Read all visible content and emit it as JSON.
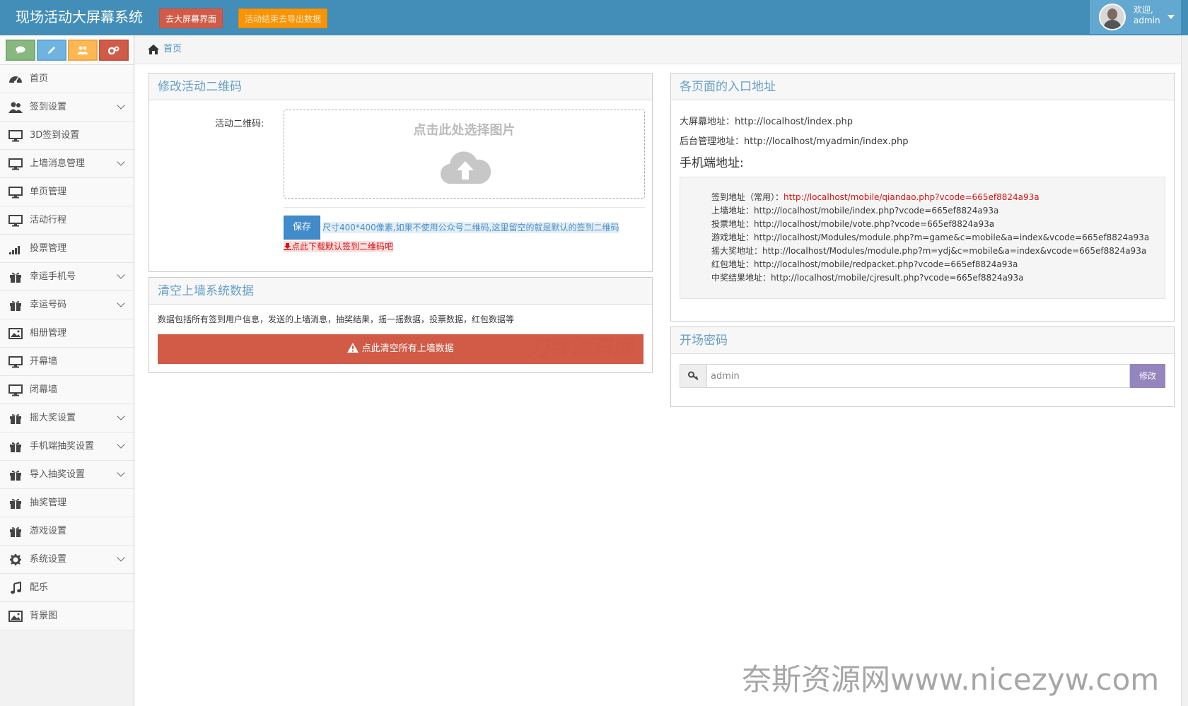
{
  "navbar": {
    "brand": "现场活动大屏幕系统",
    "btn_screen": "去大屏幕界面",
    "btn_export": "活动结束去导出数据",
    "welcome": "欢迎,",
    "username": "admin"
  },
  "shortcuts": [
    "comments-icon",
    "pencil-icon",
    "users-icon",
    "cogs-icon"
  ],
  "sidebar": {
    "items": [
      {
        "label": "首页",
        "icon": "dashboard-icon",
        "expandable": false
      },
      {
        "label": "签到设置",
        "icon": "users-icon",
        "expandable": true
      },
      {
        "label": "3D签到设置",
        "icon": "desktop-icon",
        "expandable": false
      },
      {
        "label": "上墙消息管理",
        "icon": "desktop-icon",
        "expandable": true
      },
      {
        "label": "单页管理",
        "icon": "desktop-icon",
        "expandable": false
      },
      {
        "label": "活动行程",
        "icon": "desktop-icon",
        "expandable": false
      },
      {
        "label": "投票管理",
        "icon": "signal-icon",
        "expandable": false
      },
      {
        "label": "幸运手机号",
        "icon": "gift-icon",
        "expandable": true
      },
      {
        "label": "幸运号码",
        "icon": "gift-icon",
        "expandable": true
      },
      {
        "label": "相册管理",
        "icon": "picture-icon",
        "expandable": false
      },
      {
        "label": "开幕墙",
        "icon": "desktop-icon",
        "expandable": false
      },
      {
        "label": "闭幕墙",
        "icon": "desktop-icon",
        "expandable": false
      },
      {
        "label": "摇大奖设置",
        "icon": "gift-icon",
        "expandable": true
      },
      {
        "label": "手机端抽奖设置",
        "icon": "gift-icon",
        "expandable": true
      },
      {
        "label": "导入抽奖设置",
        "icon": "gift-icon",
        "expandable": true
      },
      {
        "label": "抽奖管理",
        "icon": "gift-icon",
        "expandable": false
      },
      {
        "label": "游戏设置",
        "icon": "gift-icon",
        "expandable": false
      },
      {
        "label": "系统设置",
        "icon": "cog-icon",
        "expandable": true
      },
      {
        "label": "配乐",
        "icon": "music-icon",
        "expandable": false
      },
      {
        "label": "背景图",
        "icon": "picture-icon",
        "expandable": false
      }
    ]
  },
  "breadcrumb": {
    "home": "首页"
  },
  "qr_box": {
    "title": "修改活动二维码",
    "label": "活动二维码:",
    "dropzone_text": "点击此处选择图片",
    "save": "保存",
    "hint": "尺寸400*400像素,如果不使用公众号二维码,这里留空的就是默认的签到二维码",
    "download": "点此下载默认签到二维码吧"
  },
  "clear_box": {
    "title": "清空上墙系统数据",
    "desc": "数据包括所有签到用户信息，发送的上墙消息，抽奖结果，摇一摇数据，投票数据，红包数据等",
    "button": "点此清空所有上墙数据",
    "watermark": "刀客源码网"
  },
  "entry_box": {
    "title": "各页面的入口地址",
    "screen_url": "大屏幕地址：http://localhost/index.php",
    "admin_url": "后台管理地址：http://localhost/myadmin/index.php",
    "mobile_heading": "手机端地址:",
    "signin_label": "签到地址（常用）：",
    "signin_url": "http://localhost/mobile/qiandao.php?vcode=665ef8824a93a",
    "rows": [
      "上墙地址：http://localhost/mobile/index.php?vcode=665ef8824a93a",
      "投票地址：http://localhost/mobile/vote.php?vcode=665ef8824a93a",
      "游戏地址：http://localhost/Modules/module.php?m=game&c=mobile&a=index&vcode=665ef8824a93a",
      "摇大奖地址：http://localhost/Modules/module.php?m=ydj&c=mobile&a=index&vcode=665ef8824a93a",
      "红包地址：http://localhost/mobile/redpacket.php?vcode=665ef8824a93a",
      "中奖结果地址：http://localhost/mobile/cjresult.php?vcode=665ef8824a93a"
    ]
  },
  "password_box": {
    "title": "开场密码",
    "value": "admin",
    "button": "修改"
  },
  "watermark_bottom": "奈斯资源网www.nicezyw.com",
  "colors": {
    "navbar": "#438eb9",
    "danger": "#d15b47",
    "warning": "#f89406",
    "primary": "#428bca",
    "purple": "#9585bf",
    "box_title": "#669fc7"
  }
}
